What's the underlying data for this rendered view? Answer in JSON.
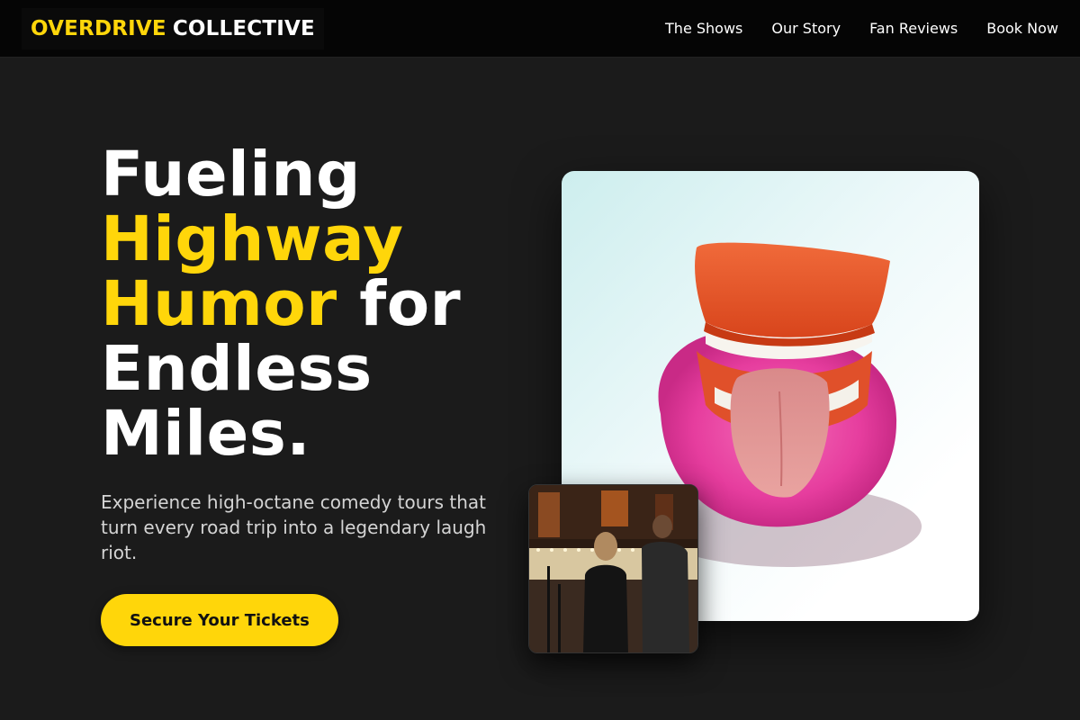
{
  "brand": {
    "part1": "OVERDRIVE",
    "part2": "COLLECTIVE"
  },
  "nav": {
    "items": [
      {
        "label": "The Shows"
      },
      {
        "label": "Our Story"
      },
      {
        "label": "Fan Reviews"
      },
      {
        "label": "Book Now"
      }
    ]
  },
  "hero": {
    "headline": {
      "line1": "Fueling",
      "line2_highlight": "Highway",
      "line3_highlight": "Humor",
      "line3_rest": " for",
      "line4": "Endless",
      "line5": "Miles."
    },
    "subtitle": "Experience high-octane comedy tours that turn every road trip into a legendary laugh riot.",
    "cta_label": "Secure Your Tickets"
  },
  "images": {
    "main_photo": {
      "subject": "wind-up chattering teeth toy with tongue on pink sponge"
    },
    "inset_photo": {
      "subject": "people at a comedy club bar"
    }
  },
  "colors": {
    "accent": "#ffd60a",
    "background": "#1b1b1b",
    "navbar": "#050505"
  }
}
